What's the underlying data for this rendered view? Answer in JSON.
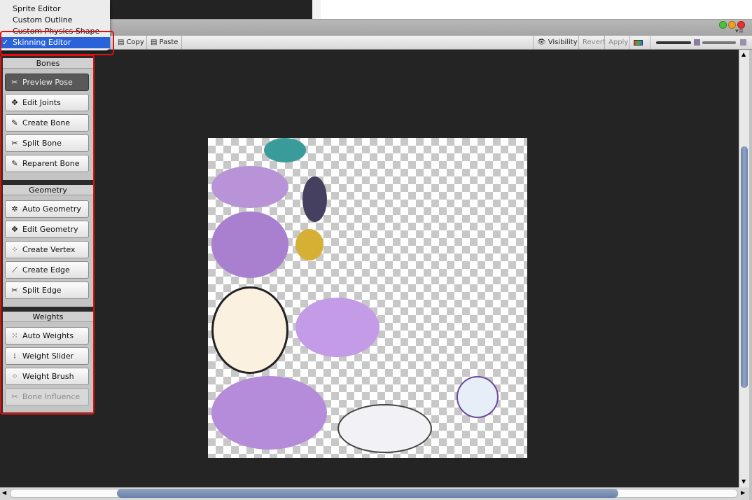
{
  "menu": {
    "items": [
      {
        "label": "Sprite Editor",
        "selected": false
      },
      {
        "label": "Custom Outline",
        "selected": false
      },
      {
        "label": "Custom Physics Shape",
        "selected": false
      },
      {
        "label": "Skinning Editor",
        "selected": true
      }
    ],
    "check": "✓"
  },
  "toolbar": {
    "copy": "Copy",
    "paste": "Paste",
    "visibility": "Visibility",
    "revert": "Revert",
    "apply": "Apply"
  },
  "panel": {
    "bones": {
      "title": "Bones",
      "buttons": [
        {
          "label": "Preview Pose",
          "icon": "preview-pose-icon",
          "state": "active"
        },
        {
          "label": "Edit Joints",
          "icon": "edit-joints-icon"
        },
        {
          "label": "Create Bone",
          "icon": "create-bone-icon"
        },
        {
          "label": "Split Bone",
          "icon": "split-bone-icon"
        },
        {
          "label": "Reparent Bone",
          "icon": "reparent-bone-icon"
        }
      ]
    },
    "geometry": {
      "title": "Geometry",
      "buttons": [
        {
          "label": "Auto Geometry",
          "icon": "auto-geometry-icon"
        },
        {
          "label": "Edit Geometry",
          "icon": "edit-geometry-icon"
        },
        {
          "label": "Create Vertex",
          "icon": "create-vertex-icon"
        },
        {
          "label": "Create Edge",
          "icon": "create-edge-icon"
        },
        {
          "label": "Split Edge",
          "icon": "split-edge-icon"
        }
      ]
    },
    "weights": {
      "title": "Weights",
      "buttons": [
        {
          "label": "Auto Weights",
          "icon": "auto-weights-icon"
        },
        {
          "label": "Weight Slider",
          "icon": "weight-slider-icon"
        },
        {
          "label": "Weight Brush",
          "icon": "weight-brush-icon"
        },
        {
          "label": "Bone Influence",
          "icon": "bone-influence-icon",
          "state": "disabled"
        }
      ]
    }
  },
  "colors": {
    "highlight": "#e01010",
    "menu_selected": "#2a62d9",
    "canvas": "#242424",
    "scroll_thumb": "#7d92b6"
  }
}
